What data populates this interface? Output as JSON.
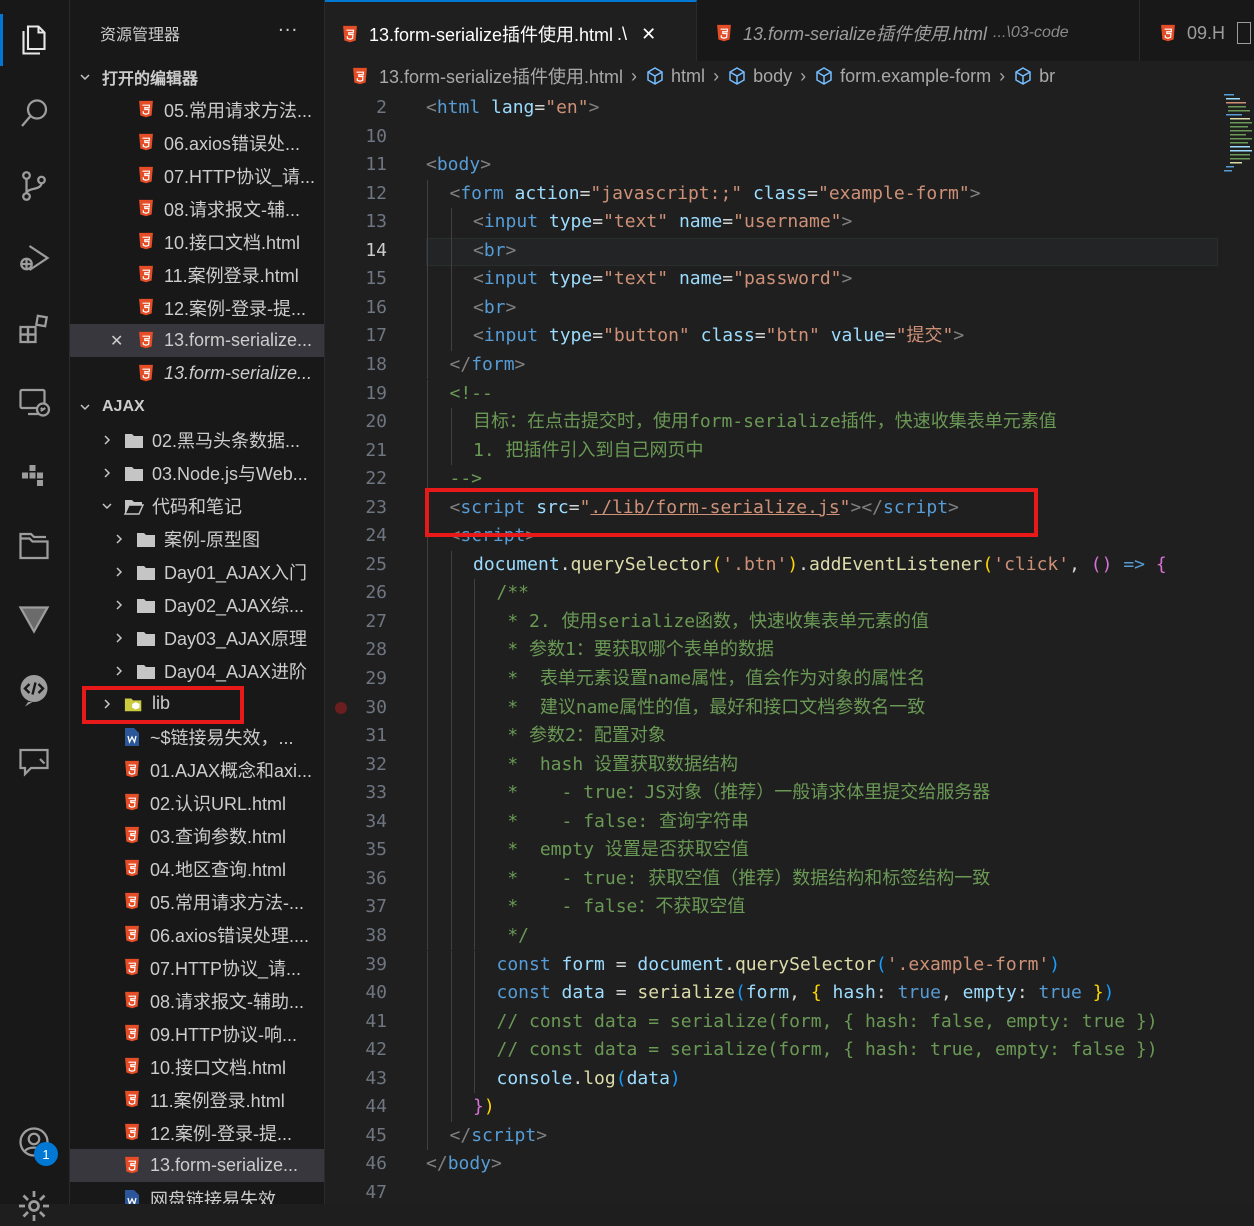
{
  "activity_bar": {
    "items": [
      {
        "name": "explorer-icon",
        "active": true
      },
      {
        "name": "search-icon"
      },
      {
        "name": "source-control-icon"
      },
      {
        "name": "run-debug-icon"
      },
      {
        "name": "extensions-icon"
      },
      {
        "name": "remote-explorer-icon"
      },
      {
        "name": "docker-icon"
      },
      {
        "name": "project-manager-icon"
      },
      {
        "name": "testing-icon"
      },
      {
        "name": "live-share-icon"
      },
      {
        "name": "chat-icon"
      }
    ],
    "accounts_badge": "1"
  },
  "sidebar": {
    "title": "资源管理器",
    "more": "···",
    "open_editors": {
      "label": "打开的编辑器",
      "items": [
        "05.常用请求方法...",
        "06.axios错误处...",
        "07.HTTP协议_请...",
        "08.请求报文-辅...",
        "10.接口文档.html",
        "11.案例登录.html",
        "12.案例-登录-提...",
        "13.form-serialize...",
        "13.form-serialize..."
      ]
    },
    "ajax": {
      "label": "AJAX",
      "folders": [
        "02.黑马头条数据...",
        "03.Node.js与Web..."
      ],
      "open_folder": "代码和笔记",
      "subfolders": [
        "案例-原型图",
        "Day01_AJAX入门",
        "Day02_AJAX综...",
        "Day03_AJAX原理",
        "Day04_AJAX进阶"
      ],
      "lib": "lib",
      "files": [
        "~$链接易失效，...",
        "01.AJAX概念和axi...",
        "02.认识URL.html",
        "03.查询参数.html",
        "04.地区查询.html",
        "05.常用请求方法-...",
        "06.axios错误处理....",
        "07.HTTP协议_请...",
        "08.请求报文-辅助...",
        "09.HTTP协议-响...",
        "10.接口文档.html",
        "11.案例登录.html",
        "12.案例-登录-提...",
        "13.form-serialize...",
        "网盘链接易失效..."
      ]
    }
  },
  "tabs": [
    {
      "label": "13.form-serialize插件使用.html",
      "suffix": ".\\",
      "close": "✕",
      "active": true
    },
    {
      "label": "13.form-serialize插件使用.html",
      "dir": "...\\03-code",
      "active": false
    },
    {
      "label": "09.H",
      "active": false
    }
  ],
  "breadcrumb": [
    "13.form-serialize插件使用.html",
    "html",
    "body",
    "form.example-form",
    "br"
  ],
  "editor": {
    "current_line": "14",
    "breakpoint_line": "30",
    "lines": [
      {
        "n": "2",
        "indent": 0,
        "t": [
          [
            "t-br",
            "<"
          ],
          [
            "t-tag",
            "html "
          ],
          [
            "t-attr",
            "lang"
          ],
          [
            "t-pl",
            "="
          ],
          [
            "t-str",
            "\"en\""
          ],
          [
            "t-br",
            ">"
          ]
        ]
      },
      {
        "n": "10",
        "indent": 0,
        "t": []
      },
      {
        "n": "11",
        "indent": 0,
        "t": [
          [
            "t-br",
            "<"
          ],
          [
            "t-tag",
            "body"
          ],
          [
            "t-br",
            ">"
          ]
        ]
      },
      {
        "n": "12",
        "indent": 1,
        "t": [
          [
            "t-br",
            "<"
          ],
          [
            "t-tag",
            "form "
          ],
          [
            "t-attr",
            "action"
          ],
          [
            "t-pl",
            "="
          ],
          [
            "t-str",
            "\"javascript:;\" "
          ],
          [
            "t-attr",
            "class"
          ],
          [
            "t-pl",
            "="
          ],
          [
            "t-str",
            "\"example-form\""
          ],
          [
            "t-br",
            ">"
          ]
        ]
      },
      {
        "n": "13",
        "indent": 2,
        "t": [
          [
            "t-br",
            "<"
          ],
          [
            "t-tag",
            "input "
          ],
          [
            "t-attr",
            "type"
          ],
          [
            "t-pl",
            "="
          ],
          [
            "t-str",
            "\"text\" "
          ],
          [
            "t-attr",
            "name"
          ],
          [
            "t-pl",
            "="
          ],
          [
            "t-str",
            "\"username\""
          ],
          [
            "t-br",
            ">"
          ]
        ]
      },
      {
        "n": "14",
        "indent": 2,
        "t": [
          [
            "t-br",
            "<"
          ],
          [
            "t-tag",
            "br"
          ],
          [
            "t-br",
            ">"
          ]
        ]
      },
      {
        "n": "15",
        "indent": 2,
        "t": [
          [
            "t-br",
            "<"
          ],
          [
            "t-tag",
            "input "
          ],
          [
            "t-attr",
            "type"
          ],
          [
            "t-pl",
            "="
          ],
          [
            "t-str",
            "\"text\" "
          ],
          [
            "t-attr",
            "name"
          ],
          [
            "t-pl",
            "="
          ],
          [
            "t-str",
            "\"password\""
          ],
          [
            "t-br",
            ">"
          ]
        ]
      },
      {
        "n": "16",
        "indent": 2,
        "t": [
          [
            "t-br",
            "<"
          ],
          [
            "t-tag",
            "br"
          ],
          [
            "t-br",
            ">"
          ]
        ]
      },
      {
        "n": "17",
        "indent": 2,
        "t": [
          [
            "t-br",
            "<"
          ],
          [
            "t-tag",
            "input "
          ],
          [
            "t-attr",
            "type"
          ],
          [
            "t-pl",
            "="
          ],
          [
            "t-str",
            "\"button\" "
          ],
          [
            "t-attr",
            "class"
          ],
          [
            "t-pl",
            "="
          ],
          [
            "t-str",
            "\"btn\" "
          ],
          [
            "t-attr",
            "value"
          ],
          [
            "t-pl",
            "="
          ],
          [
            "t-str",
            "\"提交\""
          ],
          [
            "t-br",
            ">"
          ]
        ]
      },
      {
        "n": "18",
        "indent": 1,
        "t": [
          [
            "t-br",
            "</"
          ],
          [
            "t-tag",
            "form"
          ],
          [
            "t-br",
            ">"
          ]
        ]
      },
      {
        "n": "19",
        "indent": 1,
        "t": [
          [
            "t-com",
            "<!--"
          ]
        ]
      },
      {
        "n": "20",
        "indent": 2,
        "t": [
          [
            "t-com",
            "目标：在点击提交时，使用form-serialize插件，快速收集表单元素值"
          ]
        ]
      },
      {
        "n": "21",
        "indent": 2,
        "t": [
          [
            "t-com",
            "1. 把插件引入到自己网页中"
          ]
        ]
      },
      {
        "n": "22",
        "indent": 1,
        "t": [
          [
            "t-com",
            "-->"
          ]
        ]
      },
      {
        "n": "23",
        "indent": 1,
        "t": [
          [
            "t-br",
            "<"
          ],
          [
            "t-tag",
            "script "
          ],
          [
            "t-attr",
            "src"
          ],
          [
            "t-pl",
            "="
          ],
          [
            "t-str",
            "\""
          ],
          [
            "t-str t-u",
            "./lib/form-serialize.js"
          ],
          [
            "t-str",
            "\""
          ],
          [
            "t-br",
            "></"
          ],
          [
            "t-tag",
            "script"
          ],
          [
            "t-br",
            ">"
          ]
        ]
      },
      {
        "n": "24",
        "indent": 1,
        "t": [
          [
            "t-br",
            "<"
          ],
          [
            "t-tag",
            "script"
          ],
          [
            "t-br",
            ">"
          ]
        ]
      },
      {
        "n": "25",
        "indent": 2,
        "t": [
          [
            "t-var",
            "document"
          ],
          [
            "t-pl",
            "."
          ],
          [
            "t-fn",
            "querySelector"
          ],
          [
            "t-p1",
            "("
          ],
          [
            "t-str",
            "'.btn'"
          ],
          [
            "t-p1",
            ")"
          ],
          [
            "t-pl",
            "."
          ],
          [
            "t-fn",
            "addEventListener"
          ],
          [
            "t-p1",
            "("
          ],
          [
            "t-str",
            "'click'"
          ],
          [
            "t-pl",
            ", "
          ],
          [
            "t-p2",
            "()"
          ],
          [
            "t-pl",
            " "
          ],
          [
            "t-kw",
            "=>"
          ],
          [
            "t-pl",
            " "
          ],
          [
            "t-p2",
            "{"
          ]
        ]
      },
      {
        "n": "26",
        "indent": 3,
        "t": [
          [
            "t-com",
            "/**"
          ]
        ]
      },
      {
        "n": "27",
        "indent": 3,
        "t": [
          [
            "t-com",
            " * 2. 使用serialize函数，快速收集表单元素的值"
          ]
        ]
      },
      {
        "n": "28",
        "indent": 3,
        "t": [
          [
            "t-com",
            " * 参数1：要获取哪个表单的数据"
          ]
        ]
      },
      {
        "n": "29",
        "indent": 3,
        "t": [
          [
            "t-com",
            " *  表单元素设置name属性，值会作为对象的属性名"
          ]
        ]
      },
      {
        "n": "30",
        "indent": 3,
        "t": [
          [
            "t-com",
            " *  建议name属性的值，最好和接口文档参数名一致"
          ]
        ]
      },
      {
        "n": "31",
        "indent": 3,
        "t": [
          [
            "t-com",
            " * 参数2：配置对象"
          ]
        ]
      },
      {
        "n": "32",
        "indent": 3,
        "t": [
          [
            "t-com",
            " *  hash 设置获取数据结构"
          ]
        ]
      },
      {
        "n": "33",
        "indent": 3,
        "t": [
          [
            "t-com",
            " *    - true：JS对象（推荐）一般请求体里提交给服务器"
          ]
        ]
      },
      {
        "n": "34",
        "indent": 3,
        "t": [
          [
            "t-com",
            " *    - false: 查询字符串"
          ]
        ]
      },
      {
        "n": "35",
        "indent": 3,
        "t": [
          [
            "t-com",
            " *  empty 设置是否获取空值"
          ]
        ]
      },
      {
        "n": "36",
        "indent": 3,
        "t": [
          [
            "t-com",
            " *    - true: 获取空值（推荐）数据结构和标签结构一致"
          ]
        ]
      },
      {
        "n": "37",
        "indent": 3,
        "t": [
          [
            "t-com",
            " *    - false：不获取空值"
          ]
        ]
      },
      {
        "n": "38",
        "indent": 3,
        "t": [
          [
            "t-com",
            " */"
          ]
        ]
      },
      {
        "n": "39",
        "indent": 3,
        "t": [
          [
            "t-kw",
            "const "
          ],
          [
            "t-var",
            "form"
          ],
          [
            "t-pl",
            " = "
          ],
          [
            "t-var",
            "document"
          ],
          [
            "t-pl",
            "."
          ],
          [
            "t-fn",
            "querySelector"
          ],
          [
            "t-p3",
            "("
          ],
          [
            "t-str",
            "'.example-form'"
          ],
          [
            "t-p3",
            ")"
          ]
        ]
      },
      {
        "n": "40",
        "indent": 3,
        "t": [
          [
            "t-kw",
            "const "
          ],
          [
            "t-var",
            "data"
          ],
          [
            "t-pl",
            " = "
          ],
          [
            "t-fn",
            "serialize"
          ],
          [
            "t-p3",
            "("
          ],
          [
            "t-var",
            "form"
          ],
          [
            "t-pl",
            ", "
          ],
          [
            "t-p1",
            "{ "
          ],
          [
            "t-var",
            "hash"
          ],
          [
            "t-pl",
            ": "
          ],
          [
            "t-kw",
            "true"
          ],
          [
            "t-pl",
            ", "
          ],
          [
            "t-var",
            "empty"
          ],
          [
            "t-pl",
            ": "
          ],
          [
            "t-kw",
            "true"
          ],
          [
            "t-p1",
            " }"
          ],
          [
            "t-p3",
            ")"
          ]
        ]
      },
      {
        "n": "41",
        "indent": 3,
        "t": [
          [
            "t-com",
            "// const data = serialize(form, { hash: false, empty: true })"
          ]
        ]
      },
      {
        "n": "42",
        "indent": 3,
        "t": [
          [
            "t-com",
            "// const data = serialize(form, { hash: true, empty: false })"
          ]
        ]
      },
      {
        "n": "43",
        "indent": 3,
        "t": [
          [
            "t-var",
            "console"
          ],
          [
            "t-pl",
            "."
          ],
          [
            "t-fn",
            "log"
          ],
          [
            "t-p3",
            "("
          ],
          [
            "t-var",
            "data"
          ],
          [
            "t-p3",
            ")"
          ]
        ]
      },
      {
        "n": "44",
        "indent": 2,
        "t": [
          [
            "t-p2",
            "}"
          ],
          [
            "t-p1",
            ")"
          ]
        ]
      },
      {
        "n": "45",
        "indent": 1,
        "t": [
          [
            "t-br",
            "</"
          ],
          [
            "t-tag",
            "script"
          ],
          [
            "t-br",
            ">"
          ]
        ]
      },
      {
        "n": "46",
        "indent": 0,
        "t": [
          [
            "t-br",
            "</"
          ],
          [
            "t-tag",
            "body"
          ],
          [
            "t-br",
            ">"
          ]
        ]
      },
      {
        "n": "47",
        "indent": 0,
        "t": []
      }
    ]
  },
  "colors": {
    "accent": "#0078d4",
    "highlight_box": "#e81919",
    "html_icon": "#e44d26",
    "folder": "#c5c5c5",
    "lib_folder": "#cbcb41"
  }
}
